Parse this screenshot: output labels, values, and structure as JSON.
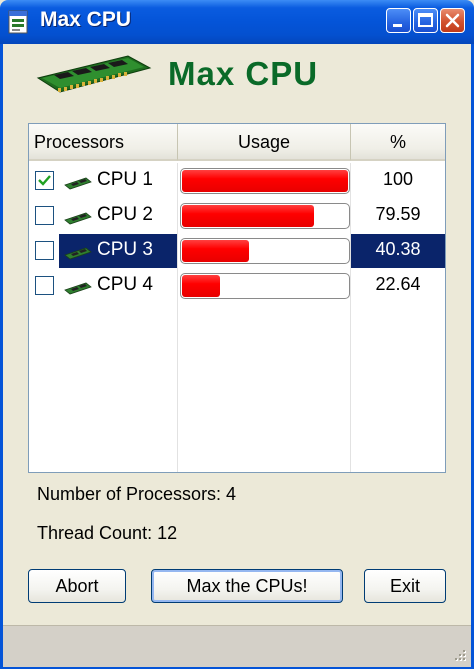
{
  "window": {
    "title": "Max CPU",
    "icon": "app-window-icon",
    "controls": [
      "minimize-icon",
      "maximize-icon",
      "close-icon"
    ]
  },
  "header": {
    "title": "Max CPU",
    "logo": "ram-module-icon",
    "title_color": "#0a6a28"
  },
  "list": {
    "columns": [
      "Processors",
      "Usage",
      "%"
    ],
    "rows": [
      {
        "checked": true,
        "name": "CPU 1",
        "usage": 100,
        "pct": "100",
        "selected": false
      },
      {
        "checked": false,
        "name": "CPU 2",
        "usage": 79.59,
        "pct": "79.59",
        "selected": false
      },
      {
        "checked": false,
        "name": "CPU 3",
        "usage": 40.38,
        "pct": "40.38",
        "selected": true
      },
      {
        "checked": false,
        "name": "CPU 4",
        "usage": 22.64,
        "pct": "22.64",
        "selected": false
      }
    ],
    "bar_color": "#ff0000",
    "selection_color": "#0a246a"
  },
  "info": {
    "processors": "Number of Processors: 4",
    "threads": "Thread Count: 12"
  },
  "buttons": {
    "abort": "Abort",
    "max": "Max the CPUs!",
    "exit": "Exit"
  }
}
